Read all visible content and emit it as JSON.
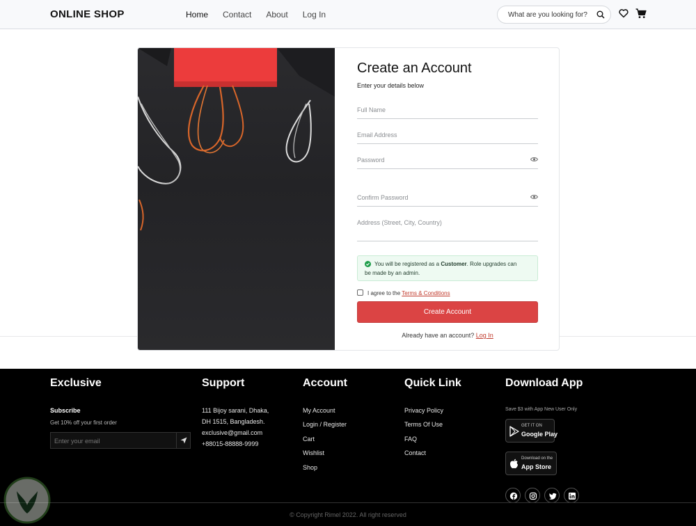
{
  "header": {
    "logo": "ONLINE SHOP",
    "nav": [
      "Home",
      "Contact",
      "About",
      "Log In"
    ],
    "search_placeholder": "What are you looking for?",
    "icons": [
      "search-icon",
      "heart-icon",
      "cart-icon"
    ]
  },
  "form": {
    "title": "Create an Account",
    "subtitle": "Enter your details below",
    "full_name_placeholder": "Full Name",
    "email_placeholder": "Email Address",
    "password_placeholder": "Password",
    "confirm_password_placeholder": "Confirm Password",
    "address_placeholder": "Address (Street, City, Country)",
    "notice_prefix": "You will be registered as a",
    "notice_role": "Customer",
    "notice_suffix": ". Role upgrades can",
    "notice_line2": "be made by an admin.",
    "agree_prefix": "I agree to the",
    "terms_link": "Terms & Conditions",
    "submit_label": "Create Account",
    "already_text": "Already have an account?",
    "login_link": "Log In"
  },
  "footer": {
    "exclusive": {
      "title": "Exclusive",
      "subscribe": "Subscribe",
      "offer": "Get 10% off your first order",
      "email_placeholder": "Enter your email"
    },
    "support": {
      "title": "Support",
      "address_line1": "111 Bijoy sarani, Dhaka,",
      "address_line2": "DH 1515, Bangladesh.",
      "email": "exclusive@gmail.com",
      "phone": "+88015-88888-9999"
    },
    "account": {
      "title": "Account",
      "items": [
        "My Account",
        "Login / Register",
        "Cart",
        "Wishlist",
        "Shop"
      ]
    },
    "quick_link": {
      "title": "Quick Link",
      "items": [
        "Privacy Policy",
        "Terms Of Use",
        "FAQ",
        "Contact"
      ]
    },
    "download": {
      "title": "Download App",
      "promo": "Save $3 with App New User Only",
      "google_small": "GET IT ON",
      "google_big": "Google Play",
      "apple_small": "Download on the",
      "apple_big": "App Store"
    },
    "social_icons": [
      "facebook-icon",
      "instagram-icon",
      "twitter-icon",
      "linkedin-icon"
    ],
    "copyright": "© Copyright Rimel 2022. All right reserved"
  },
  "colors": {
    "accent": "#db4444",
    "notice_bg": "#eefaf2",
    "notice_icon": "#1e9e4a",
    "footer_bg": "#000000"
  }
}
